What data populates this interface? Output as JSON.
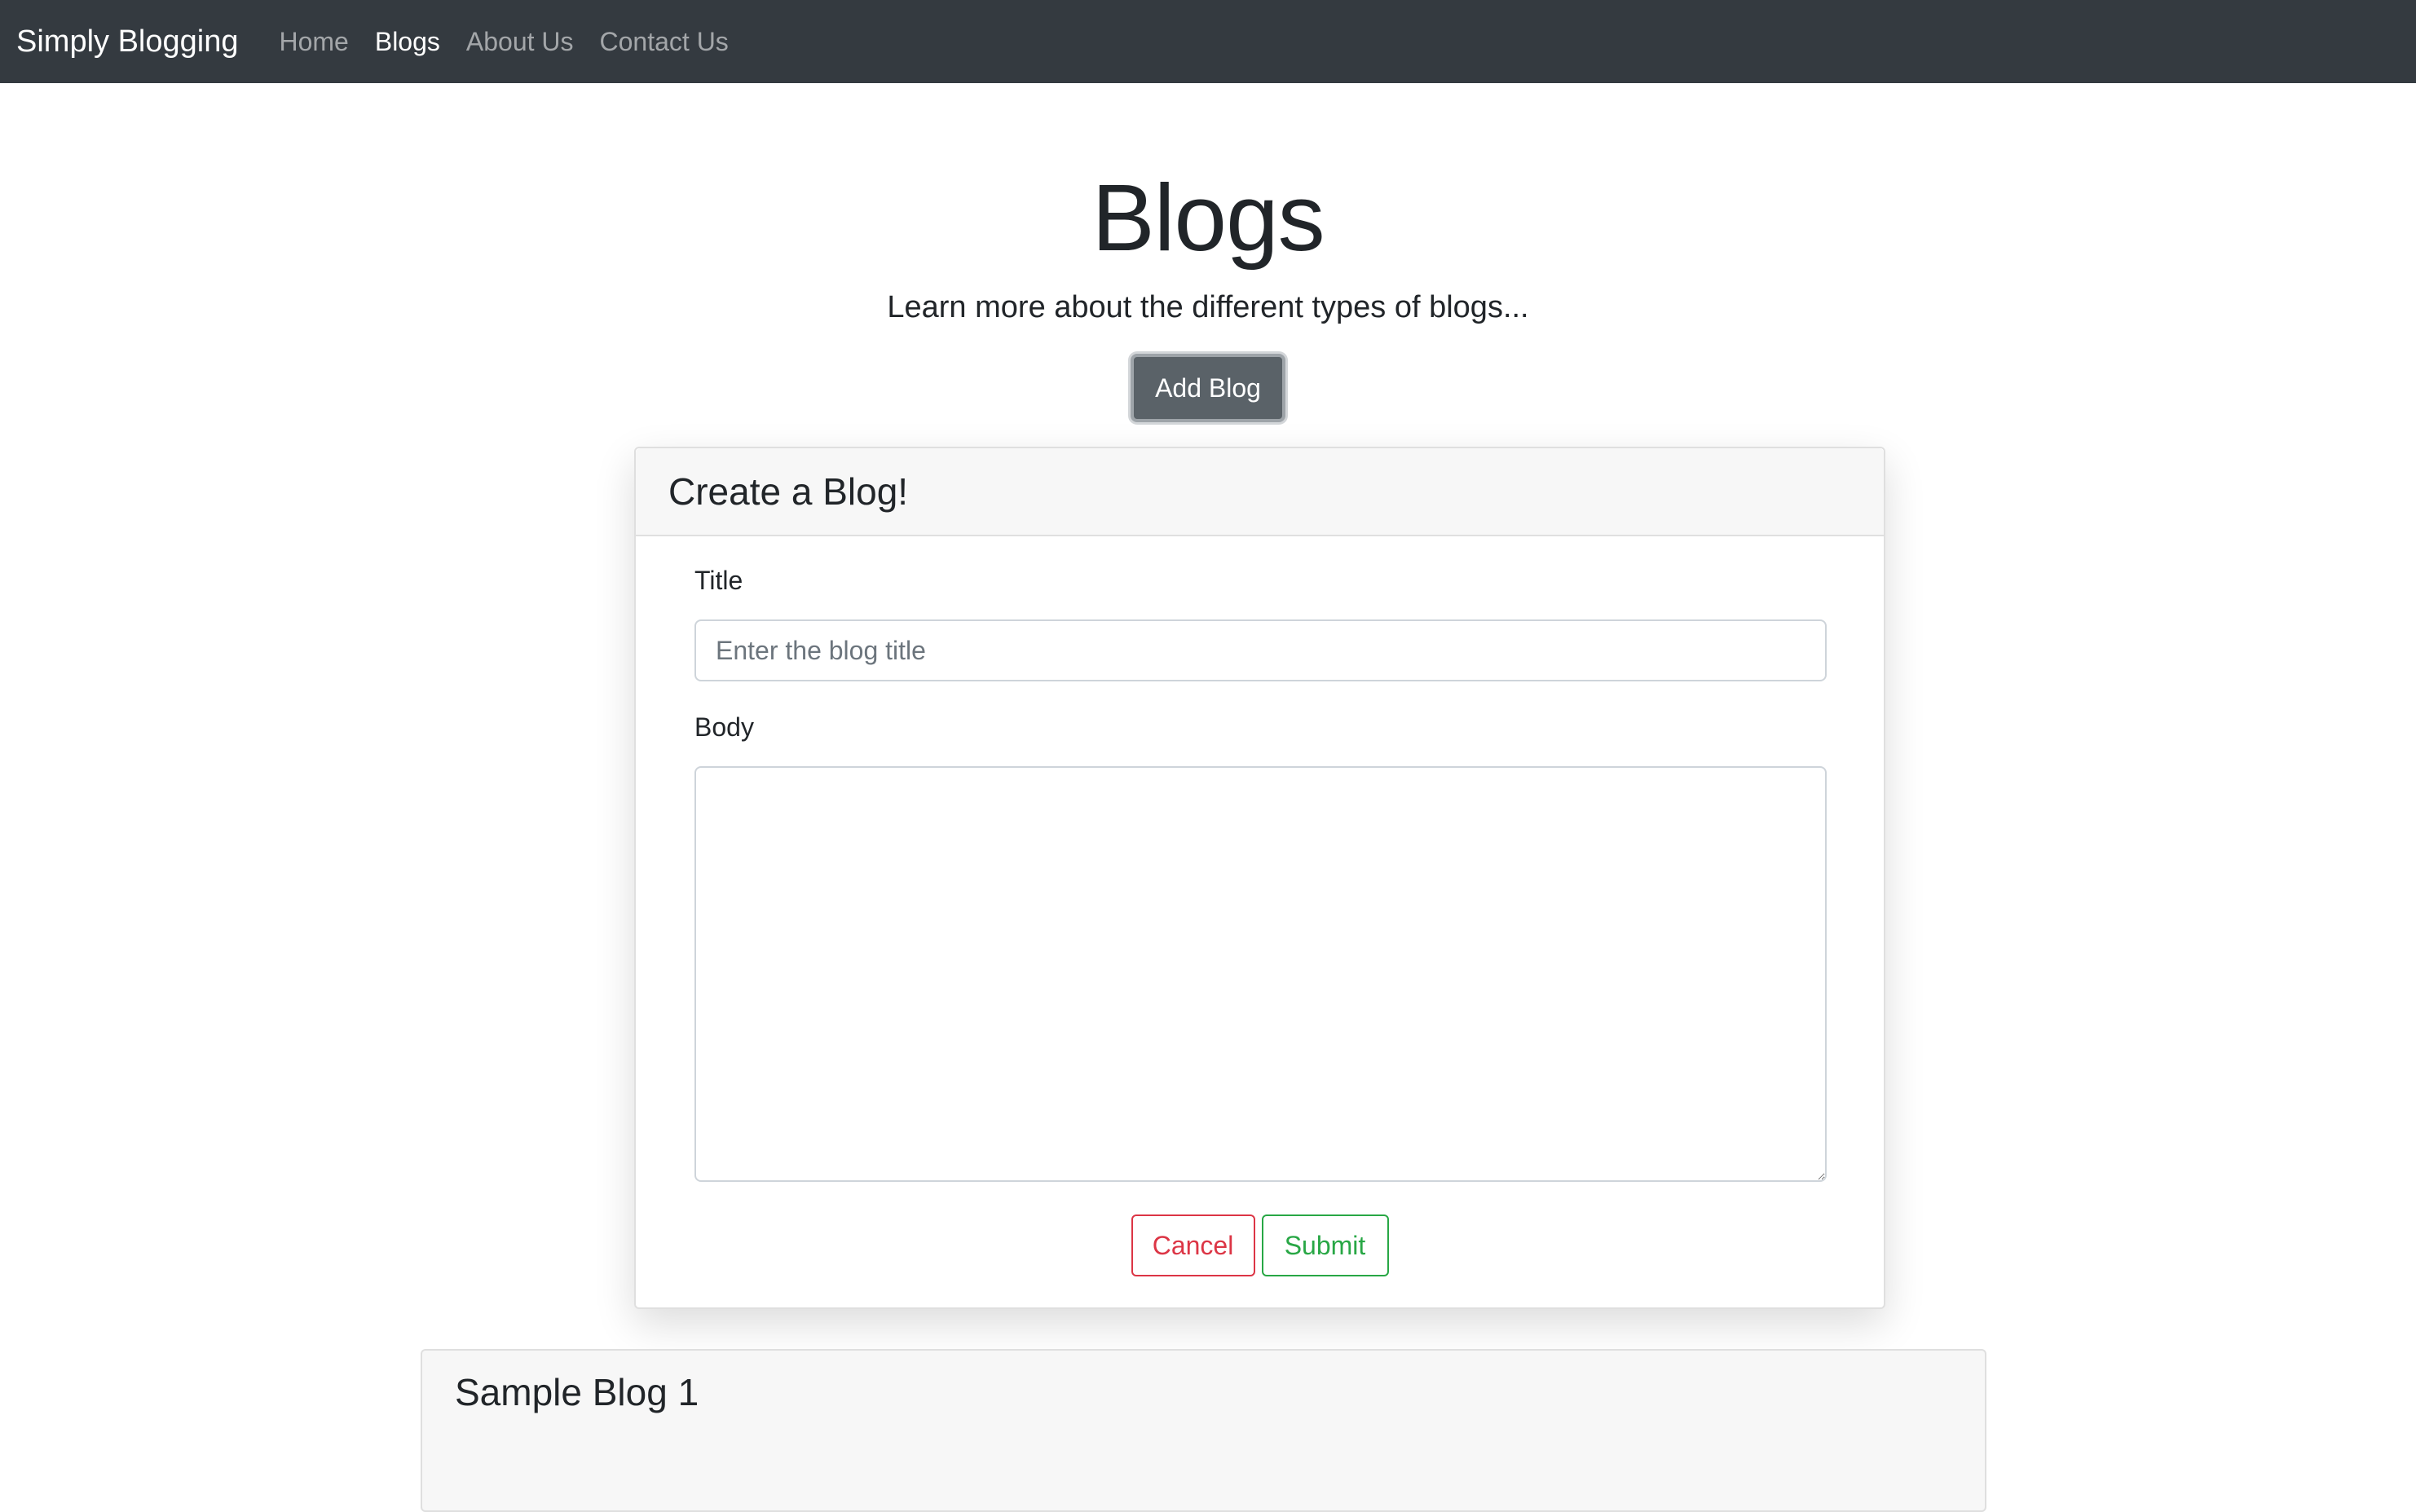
{
  "navbar": {
    "brand": "Simply Blogging",
    "links": [
      {
        "label": "Home",
        "active": false
      },
      {
        "label": "Blogs",
        "active": true
      },
      {
        "label": "About Us",
        "active": false
      },
      {
        "label": "Contact Us",
        "active": false
      }
    ],
    "background_color": "#343a40"
  },
  "hero": {
    "title": "Blogs",
    "subtitle": "Learn more about the different types of blogs...",
    "add_button_label": "Add Blog"
  },
  "create_form": {
    "header": "Create a Blog!",
    "title_label": "Title",
    "title_placeholder": "Enter the blog title",
    "title_value": "",
    "body_label": "Body",
    "body_value": "",
    "cancel_label": "Cancel",
    "submit_label": "Submit",
    "cancel_color": "#dc3545",
    "submit_color": "#28a745"
  },
  "blogs": [
    {
      "title": "Sample Blog 1"
    }
  ]
}
